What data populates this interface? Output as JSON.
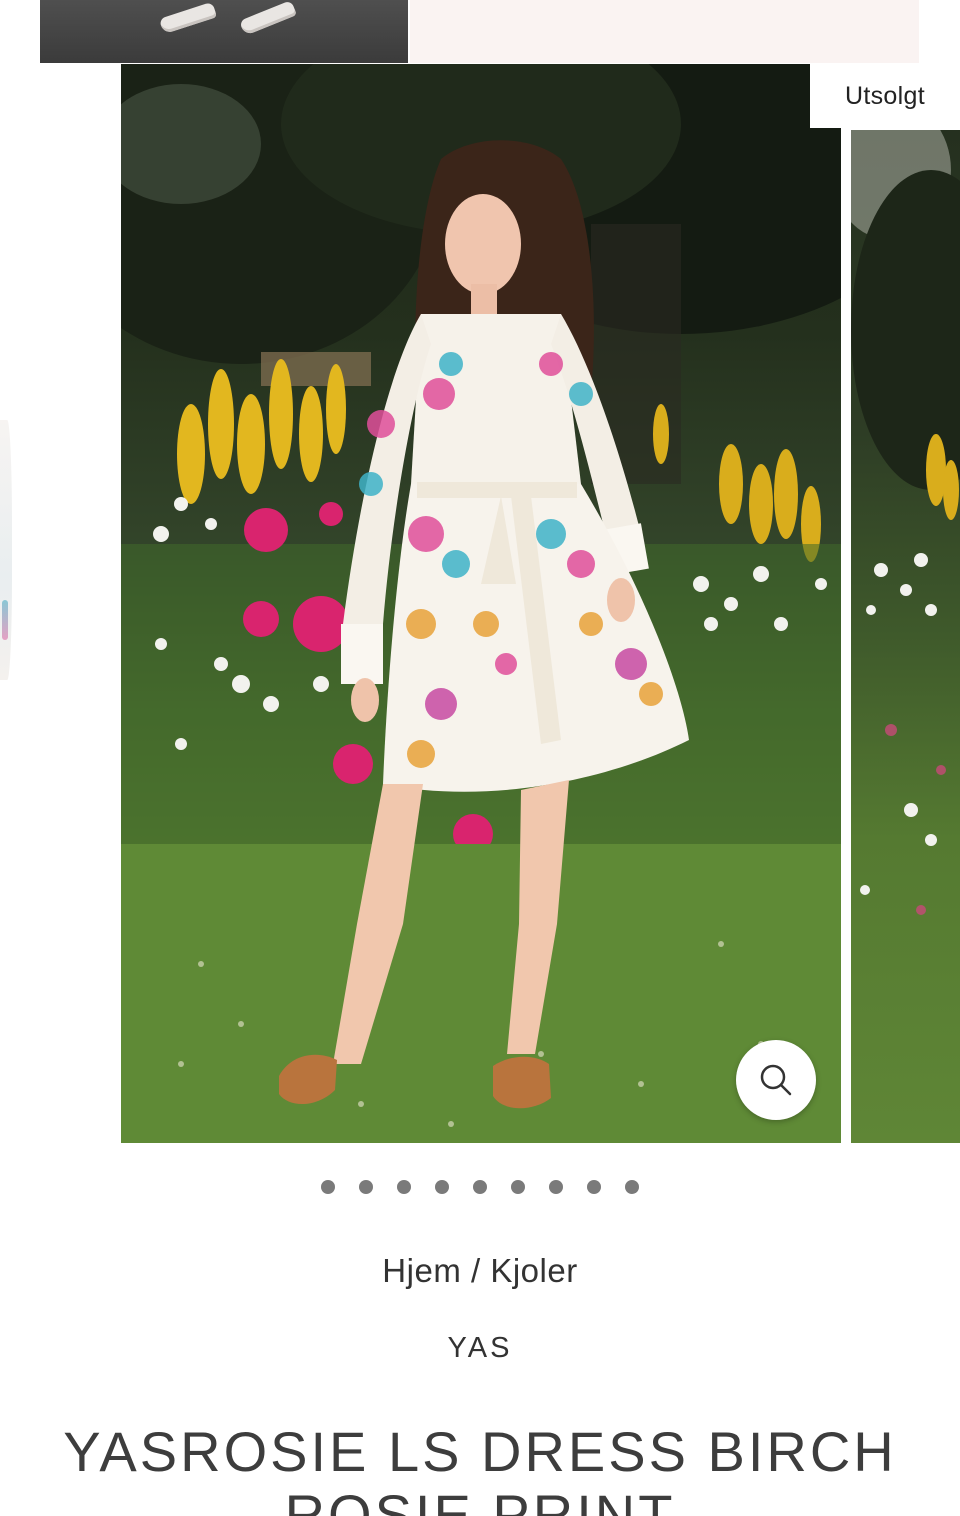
{
  "badge": {
    "sold_out": "Utsolgt"
  },
  "gallery": {
    "slide_count": 9,
    "dots": [
      1,
      2,
      3,
      4,
      5,
      6,
      7,
      8,
      9
    ],
    "zoom_icon": "magnifier-icon"
  },
  "breadcrumb": {
    "home": "Hjem",
    "separator": " / ",
    "category": "Kjoler"
  },
  "product": {
    "brand": "YAS",
    "title": "YASROSIE LS DRESS BIRCH ROSIE PRINT"
  }
}
